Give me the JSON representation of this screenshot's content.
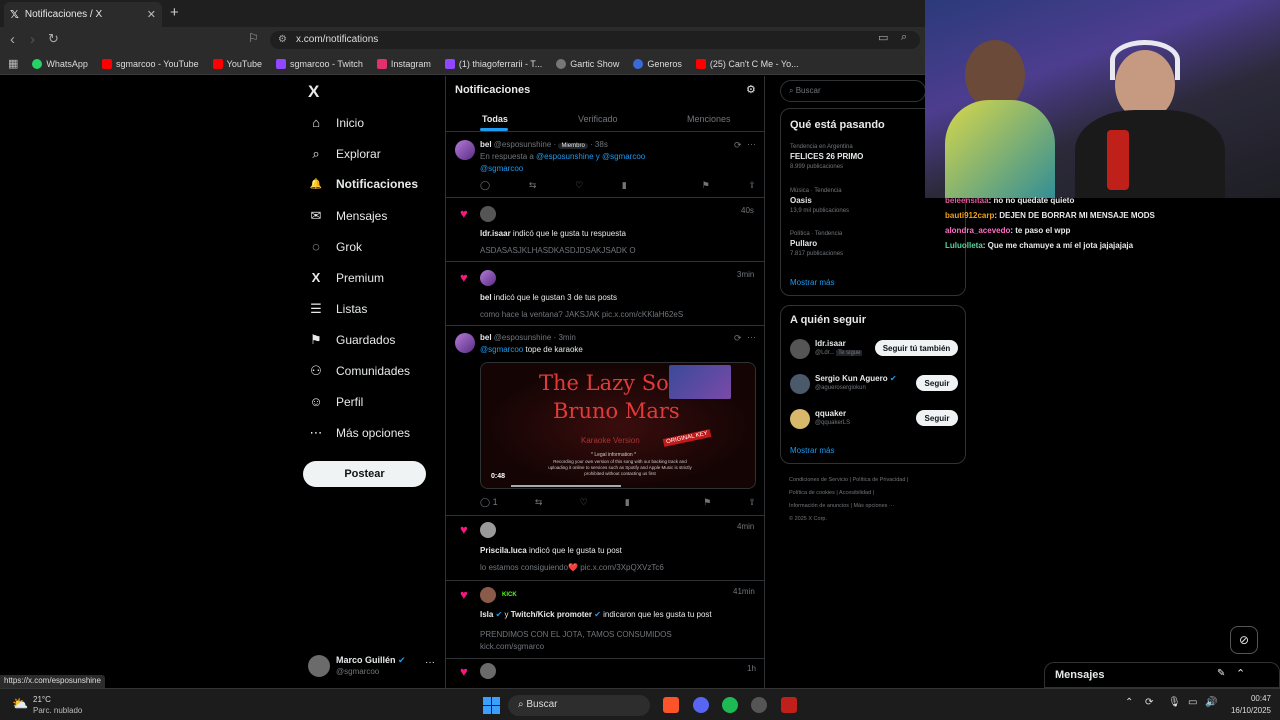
{
  "browser": {
    "tab_title": "Notificaciones / X",
    "tab_close": "✕",
    "new_tab": "+",
    "url": "x.com/notifications",
    "bookmarks": [
      {
        "label": "WhatsApp",
        "color": "#25d366"
      },
      {
        "label": "sgmarcoo - YouTube",
        "color": "#ff0000"
      },
      {
        "label": "YouTube",
        "color": "#ff0000"
      },
      {
        "label": "sgmarcoo - Twitch",
        "color": "#9146ff"
      },
      {
        "label": "Instagram",
        "color": "#e1306c"
      },
      {
        "label": "(1) thiagoferrarii - T...",
        "color": "#9146ff"
      },
      {
        "label": "Gartic Show",
        "color": "#777777"
      },
      {
        "label": "Generos",
        "color": "#3b6ad8"
      },
      {
        "label": "(25) Can't C Me - Yo...",
        "color": "#ff0000"
      }
    ],
    "status_url": "https://x.com/esposunshine"
  },
  "nav": {
    "logo": "X",
    "items": [
      {
        "label": "Inicio",
        "icon": "home-icon",
        "glyph": "⌂"
      },
      {
        "label": "Explorar",
        "icon": "search-icon",
        "glyph": "⌕"
      },
      {
        "label": "Notificaciones",
        "icon": "bell-icon",
        "glyph": "🔔"
      },
      {
        "label": "Mensajes",
        "icon": "mail-icon",
        "glyph": "✉"
      },
      {
        "label": "Grok",
        "icon": "grok-icon",
        "glyph": "◌"
      },
      {
        "label": "Premium",
        "icon": "x-premium-icon",
        "glyph": "X"
      },
      {
        "label": "Listas",
        "icon": "list-icon",
        "glyph": "☰"
      },
      {
        "label": "Guardados",
        "icon": "bookmark-icon",
        "glyph": "⚑"
      },
      {
        "label": "Comunidades",
        "icon": "people-icon",
        "glyph": "⚇"
      },
      {
        "label": "Perfil",
        "icon": "person-icon",
        "glyph": "☺"
      },
      {
        "label": "Más opciones",
        "icon": "more-circle-icon",
        "glyph": "⋯"
      }
    ],
    "post_label": "Postear",
    "profile_name": "Marco Guillén",
    "profile_handle": "@sgmarcoo",
    "profile_more": "···"
  },
  "main": {
    "title": "Notificaciones",
    "tabs": [
      "Todas",
      "Verificado",
      "Menciones"
    ],
    "reply_post": {
      "name": "bel",
      "handle": "@esposunshine",
      "badge": "Miembro",
      "time": "38s",
      "reply_prefix": "En respuesta a",
      "reply_users": "@esposunshine y @sgmarcoo",
      "text": "@sgmarcoo"
    },
    "n1": {
      "time": "40s",
      "user": "ldr.isaar",
      "action": "indicó que le gusta tu respuesta",
      "text": "ASDASASJKLHASDKASDJDSAKJSADK O"
    },
    "n2": {
      "time": "3min",
      "user": "bel",
      "action": "indicó que le gustan 3 de tus posts",
      "text": "como hace la ventana? JAKSJAK pic.x.com/cKKlaH62eS"
    },
    "video_post": {
      "name": "bel",
      "handle": "@esposunshine",
      "time": "3min",
      "mention": "@sgmarcoo",
      "text": "tope de karaoke",
      "video_title_1": "The Lazy So",
      "video_title_2": "Bruno Mars",
      "video_sub": "Karaoke Version",
      "video_tag": "ORIGINAL KEY",
      "video_caption": "Recording your own version of this song with our backing track and uploading it online to services such as Spotify and Apple Music is strictly prohibited without contacting us first",
      "video_legal": "* Legal information *",
      "video_time": "0:48",
      "replies": "1"
    },
    "n3": {
      "time": "4min",
      "user": "Priscila.luca",
      "action": "indicó que le gusta tu post",
      "text": "lo estamos consiguiendo❤️ pic.x.com/3XpQXVzTc6"
    },
    "n4": {
      "time": "41min",
      "user1": "Isla",
      "joiner": "y",
      "user2": "Twitch/Kick promoter",
      "action": "indicaron que les gusta tu post",
      "text1": "PRENDIMOS CON EL JOTA, TAMOS CONSUMIDOS",
      "text2": "kick.com/sgmarco",
      "kick_label": "KICK"
    },
    "n5": {
      "time": "1h"
    }
  },
  "right": {
    "search_placeholder": "Buscar",
    "trends_title": "Qué está pasando",
    "trends": [
      {
        "meta": "Tendencia en Argentina",
        "name": "FELICES 26 PRIMO",
        "count": "8.999 publicaciones"
      },
      {
        "meta": "Música · Tendencia",
        "name": "Oasis",
        "count": "13,9 mil publicaciones"
      },
      {
        "meta": "Política · Tendencia",
        "name": "Pullaro",
        "count": "7.817 publicaciones"
      }
    ],
    "show_more": "Mostrar más",
    "follow_title": "A quién seguir",
    "follow": [
      {
        "name": "ldr.isaar",
        "handle": "@Ldr...",
        "badge": "Te sigue",
        "button": "Seguir tú también"
      },
      {
        "name": "Sergio Kun Aguero",
        "handle": "@aguerosergiokun",
        "button": "Seguir"
      },
      {
        "name": "qquaker",
        "handle": "@qquakerLS",
        "button": "Seguir"
      }
    ],
    "show_more_2": "Mostrar más",
    "footer": [
      "Condiciones de Servicio",
      "Política de Privacidad",
      "Política de cookies",
      "Accesibilidad",
      "Información de anuncios",
      "Más opciones ···",
      "© 2025 X Corp."
    ],
    "messages_label": "Mensajes"
  },
  "stream_chat": [
    {
      "user": "beleensitaa",
      "user_color": "#e05a9a",
      "text": ": no no quedate quieto"
    },
    {
      "user": "bauti912carp",
      "user_color": "#f0a020",
      "text": ": DEJEN DE BORRAR MI MENSAJE MODS"
    },
    {
      "user": "alondra_acevedo",
      "user_color": "#ff6ec7",
      "text": ": te paso el wpp"
    },
    {
      "user": "Luluolleta",
      "user_color": "#5dd39e",
      "text": ": Que me chamuye a mí el jota jajajajaja"
    }
  ],
  "taskbar": {
    "weather_temp": "21°C",
    "weather_desc": "Parc. nublado",
    "search_label": "Buscar",
    "time": "00:47",
    "date": "16/10/2025"
  },
  "colors": {
    "accent": "#1d9bf0",
    "like": "#f91880",
    "bg": "#000000"
  }
}
